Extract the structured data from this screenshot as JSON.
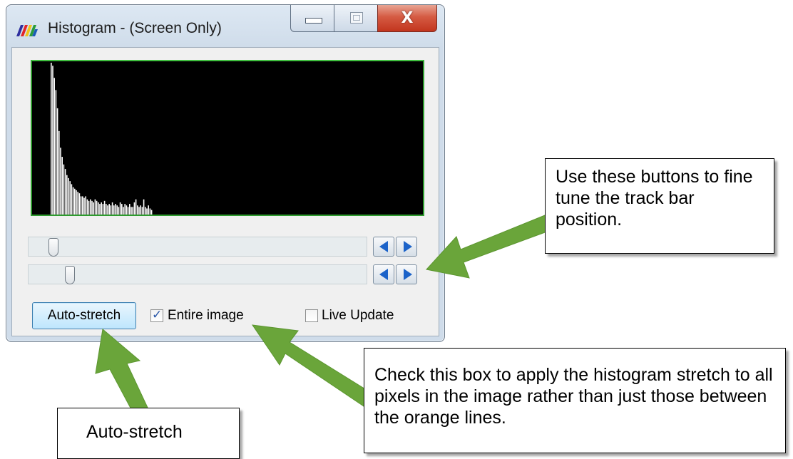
{
  "window": {
    "title": "Histogram - (Screen Only)",
    "close_glyph": "X",
    "icon": "rainbow-app-icon"
  },
  "histogram": {
    "background": "#000000",
    "border_color": "#2e9b2e",
    "bar_color": "#ffffff",
    "bins": [
      1.0,
      0.98,
      0.9,
      0.82,
      0.7,
      0.55,
      0.44,
      0.38,
      0.33,
      0.3,
      0.26,
      0.24,
      0.22,
      0.2,
      0.18,
      0.17,
      0.16,
      0.15,
      0.14,
      0.12,
      0.12,
      0.11,
      0.12,
      0.1,
      0.09,
      0.1,
      0.09,
      0.08,
      0.1,
      0.09,
      0.08,
      0.07,
      0.08,
      0.07,
      0.09,
      0.07,
      0.06,
      0.07,
      0.06,
      0.08,
      0.06,
      0.07,
      0.06,
      0.05,
      0.08,
      0.07,
      0.05,
      0.07,
      0.06,
      0.05,
      0.07,
      0.05,
      0.05,
      0.08,
      0.1,
      0.06,
      0.05,
      0.06,
      0.05,
      0.1,
      0.05,
      0.04,
      0.06,
      0.04,
      0.03
    ]
  },
  "sliders": [
    {
      "name": "lower-trackbar",
      "value": 0.06
    },
    {
      "name": "upper-trackbar",
      "value": 0.11
    }
  ],
  "controls": {
    "auto_stretch_label": "Auto-stretch",
    "entire_image_label": "Entire image",
    "entire_image_checked": true,
    "live_update_label": "Live Update",
    "live_update_checked": false
  },
  "callouts": {
    "buttons_note": "Use these buttons to fine tune the track bar position.",
    "checkbox_note": "Check this box to apply the histogram stretch to all pixels in the image rather than just those between the orange lines.",
    "autostretch_note": "Auto-stretch"
  },
  "colors": {
    "arrow_green": "#6aa53a",
    "arrow_button_blue": "#1c63c9",
    "check_blue": "#2a57a8"
  }
}
